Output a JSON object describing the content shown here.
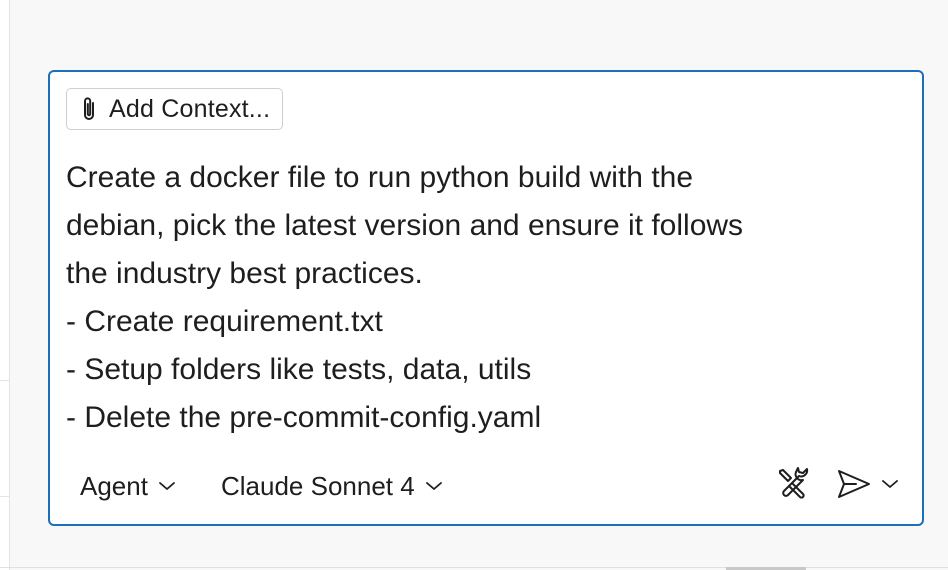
{
  "chat_input": {
    "add_context_label": "Add Context...",
    "prompt_lines": [
      "Create a docker file to run python build with the",
      "debian, pick the latest version and ensure it follows",
      "the industry best practices.",
      "- Create requirement.txt",
      "- Setup folders like tests, data, utils",
      "- Delete the pre-commit-config.yaml"
    ]
  },
  "toolbar": {
    "mode_label": "Agent",
    "model_label": "Claude Sonnet 4"
  },
  "icons": {
    "attach": "paperclip-icon",
    "mode_chevron": "chevron-down-icon",
    "model_chevron": "chevron-down-icon",
    "tools": "tools-icon",
    "send": "send-icon",
    "send_options": "chevron-down-icon"
  },
  "colors": {
    "focus_border": "#1f6fb8",
    "text": "#1e1e1e",
    "background": "#f8f8f8"
  }
}
